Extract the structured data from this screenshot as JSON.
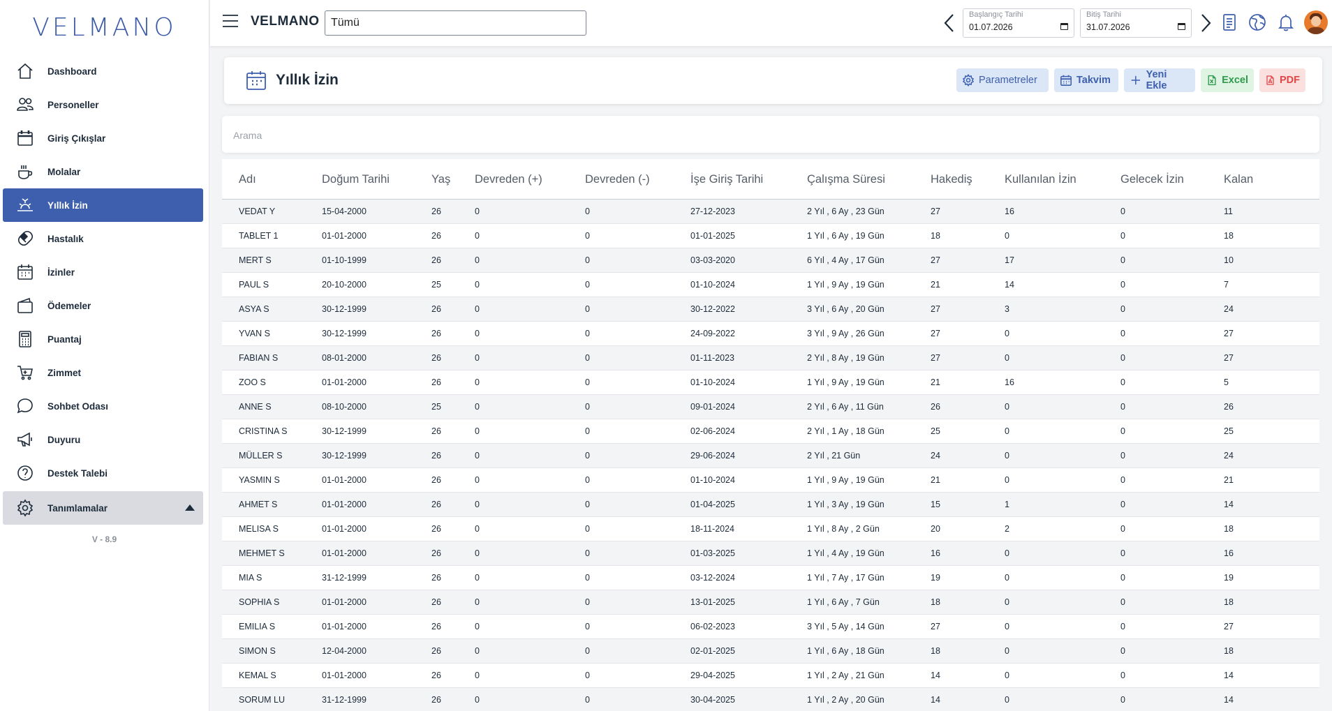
{
  "app": {
    "logo": "VELMANO",
    "brand": "VELMANO",
    "filter_value": "Tümü",
    "version": "V - 8.9"
  },
  "sidebar": {
    "items": [
      {
        "label": "Dashboard",
        "icon": "home-icon"
      },
      {
        "label": "Personeller",
        "icon": "users-icon"
      },
      {
        "label": "Giriş Çıkışlar",
        "icon": "calendar-icon"
      },
      {
        "label": "Molalar",
        "icon": "coffee-icon"
      },
      {
        "label": "Yıllık İzin",
        "icon": "sunrise-icon",
        "active": true
      },
      {
        "label": "Hastalık",
        "icon": "pill-icon"
      },
      {
        "label": "İzinler",
        "icon": "calendar-dots-icon"
      },
      {
        "label": "Ödemeler",
        "icon": "wallet-icon"
      },
      {
        "label": "Puantaj",
        "icon": "calculator-icon"
      },
      {
        "label": "Zimmet",
        "icon": "cart-icon"
      },
      {
        "label": "Sohbet Odası",
        "icon": "chat-icon"
      },
      {
        "label": "Duyuru",
        "icon": "megaphone-icon"
      },
      {
        "label": "Destek Talebi",
        "icon": "question-icon"
      },
      {
        "label": "Tanımlamalar",
        "icon": "gear-icon",
        "group": true
      }
    ]
  },
  "dates": {
    "start_label": "Başlangıç Tarihi",
    "start_value": "01.07.2026",
    "end_label": "Bitiş Tarihi",
    "end_value": "31.07.2026"
  },
  "page": {
    "title": "Yıllık İzin",
    "buttons": {
      "params": "Parametreler",
      "calendar": "Takvim",
      "new": "Yeni Ekle",
      "excel": "Excel",
      "pdf": "PDF"
    },
    "search_placeholder": "Arama"
  },
  "colors": {
    "accent": "#3d5fae",
    "excel": "#2e9a4b",
    "pdf": "#e04646"
  },
  "table": {
    "columns": [
      "Adı",
      "Doğum Tarihi",
      "Yaş",
      "Devreden (+)",
      "Devreden (-)",
      "İşe Giriş Tarihi",
      "Çalışma Süresi",
      "Hakediş",
      "Kullanılan İzin",
      "Gelecek İzin",
      "Kalan"
    ],
    "rows": [
      [
        "VEDAT Y",
        "15-04-2000",
        "26",
        "0",
        "0",
        "27-12-2023",
        "2 Yıl , 6 Ay , 23 Gün",
        "27",
        "16",
        "0",
        "11"
      ],
      [
        "TABLET 1",
        "01-01-2000",
        "26",
        "0",
        "0",
        "01-01-2025",
        "1 Yıl , 6 Ay , 19 Gün",
        "18",
        "0",
        "0",
        "18"
      ],
      [
        "MERT S",
        "01-10-1999",
        "26",
        "0",
        "0",
        "03-03-2020",
        "6 Yıl , 4 Ay , 17 Gün",
        "27",
        "17",
        "0",
        "10"
      ],
      [
        "PAUL S",
        "20-10-2000",
        "25",
        "0",
        "0",
        "01-10-2024",
        "1 Yıl , 9 Ay , 19 Gün",
        "21",
        "14",
        "0",
        "7"
      ],
      [
        "ASYA S",
        "30-12-1999",
        "26",
        "0",
        "0",
        "30-12-2022",
        "3 Yıl , 6 Ay , 20 Gün",
        "27",
        "3",
        "0",
        "24"
      ],
      [
        "YVAN S",
        "30-12-1999",
        "26",
        "0",
        "0",
        "24-09-2022",
        "3 Yıl , 9 Ay , 26 Gün",
        "27",
        "0",
        "0",
        "27"
      ],
      [
        "FABIAN S",
        "08-01-2000",
        "26",
        "0",
        "0",
        "01-11-2023",
        "2 Yıl , 8 Ay , 19 Gün",
        "27",
        "0",
        "0",
        "27"
      ],
      [
        "ZOO S",
        "01-01-2000",
        "26",
        "0",
        "0",
        "01-10-2024",
        "1 Yıl , 9 Ay , 19 Gün",
        "21",
        "16",
        "0",
        "5"
      ],
      [
        "ANNE S",
        "08-10-2000",
        "25",
        "0",
        "0",
        "09-01-2024",
        "2 Yıl , 6 Ay , 11 Gün",
        "26",
        "0",
        "0",
        "26"
      ],
      [
        "CRISTINA S",
        "30-12-1999",
        "26",
        "0",
        "0",
        "02-06-2024",
        "2 Yıl , 1 Ay , 18 Gün",
        "25",
        "0",
        "0",
        "25"
      ],
      [
        "MÜLLER S",
        "30-12-1999",
        "26",
        "0",
        "0",
        "29-06-2024",
        "2 Yıl , 21 Gün",
        "24",
        "0",
        "0",
        "24"
      ],
      [
        "YASMIN S",
        "01-01-2000",
        "26",
        "0",
        "0",
        "01-10-2024",
        "1 Yıl , 9 Ay , 19 Gün",
        "21",
        "0",
        "0",
        "21"
      ],
      [
        "AHMET S",
        "01-01-2000",
        "26",
        "0",
        "0",
        "01-04-2025",
        "1 Yıl , 3 Ay , 19 Gün",
        "15",
        "1",
        "0",
        "14"
      ],
      [
        "MELISA S",
        "01-01-2000",
        "26",
        "0",
        "0",
        "18-11-2024",
        "1 Yıl , 8 Ay , 2 Gün",
        "20",
        "2",
        "0",
        "18"
      ],
      [
        "MEHMET S",
        "01-01-2000",
        "26",
        "0",
        "0",
        "01-03-2025",
        "1 Yıl , 4 Ay , 19 Gün",
        "16",
        "0",
        "0",
        "16"
      ],
      [
        "MIA S",
        "31-12-1999",
        "26",
        "0",
        "0",
        "03-12-2024",
        "1 Yıl , 7 Ay , 17 Gün",
        "19",
        "0",
        "0",
        "19"
      ],
      [
        "SOPHIA S",
        "01-01-2000",
        "26",
        "0",
        "0",
        "13-01-2025",
        "1 Yıl , 6 Ay , 7 Gün",
        "18",
        "0",
        "0",
        "18"
      ],
      [
        "EMILIA S",
        "01-01-2000",
        "26",
        "0",
        "0",
        "06-02-2023",
        "3 Yıl , 5 Ay , 14 Gün",
        "27",
        "0",
        "0",
        "27"
      ],
      [
        "SIMON S",
        "12-04-2000",
        "26",
        "0",
        "0",
        "02-01-2025",
        "1 Yıl , 6 Ay , 18 Gün",
        "18",
        "0",
        "0",
        "18"
      ],
      [
        "KEMAL S",
        "01-01-2000",
        "26",
        "0",
        "0",
        "29-04-2025",
        "1 Yıl , 2 Ay , 21 Gün",
        "14",
        "0",
        "0",
        "14"
      ],
      [
        "SORUM LU",
        "31-12-1999",
        "26",
        "0",
        "0",
        "30-04-2025",
        "1 Yıl , 2 Ay , 20 Gün",
        "14",
        "0",
        "0",
        "14"
      ]
    ]
  }
}
